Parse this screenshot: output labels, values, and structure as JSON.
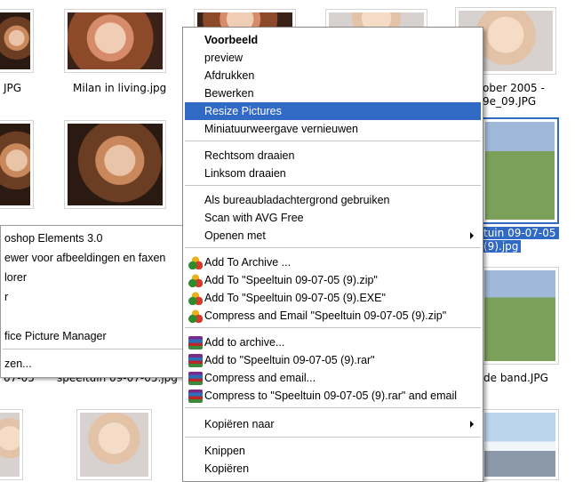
{
  "background": {
    "captions": {
      "c1": "JPG",
      "c2": "Milan in living.jpg",
      "c3": "ober 2005 -",
      "c4": "9e_09.JPG",
      "c5": "tuin 09-07-05",
      "c6": "(9).jpg",
      "c7": "07-05",
      "c8": "speeltuin 09-07-05.jpg",
      "c9": "de band.JPG"
    }
  },
  "open_with_submenu": {
    "items": [
      "oshop Elements 3.0",
      "ewer voor afbeeldingen en faxen",
      "lorer",
      "r",
      "fice Picture Manager",
      "zen..."
    ]
  },
  "context_menu": {
    "items": [
      {
        "label": "Voorbeeld",
        "bold": true
      },
      {
        "label": "preview"
      },
      {
        "label": "Afdrukken"
      },
      {
        "label": "Bewerken"
      },
      {
        "label": "Resize Pictures",
        "highlighted": true
      },
      {
        "label": "Miniatuurweergave vernieuwen"
      },
      {
        "label": "Rechtsom draaien"
      },
      {
        "label": "Linksom draaien"
      },
      {
        "label": "Als bureaubladachtergrond gebruiken"
      },
      {
        "label": "Scan with AVG Free"
      },
      {
        "label": "Openen met",
        "submenu": true
      },
      {
        "label": "Add To Archive ...",
        "icon": "winzip-icon"
      },
      {
        "label": "Add To \"Speeltuin 09-07-05 (9).zip\"",
        "icon": "winzip-icon"
      },
      {
        "label": "Add To \"Speeltuin 09-07-05 (9).EXE\"",
        "icon": "winzip-icon"
      },
      {
        "label": "Compress and Email \"Speeltuin 09-07-05 (9).zip\"",
        "icon": "winzip-icon"
      },
      {
        "label": "Add to archive...",
        "icon": "winrar-icon"
      },
      {
        "label": "Add to \"Speeltuin 09-07-05 (9).rar\"",
        "icon": "winrar-icon"
      },
      {
        "label": "Compress and email...",
        "icon": "winrar-icon"
      },
      {
        "label": "Compress to \"Speeltuin 09-07-05 (9).rar\" and email",
        "icon": "winrar-icon"
      },
      {
        "label": "Kopiëren naar",
        "submenu": true
      },
      {
        "label": "Knippen"
      },
      {
        "label": "Kopiëren"
      }
    ]
  },
  "colors": {
    "highlight": "#316ac5",
    "separator": "#c5c5c5"
  }
}
